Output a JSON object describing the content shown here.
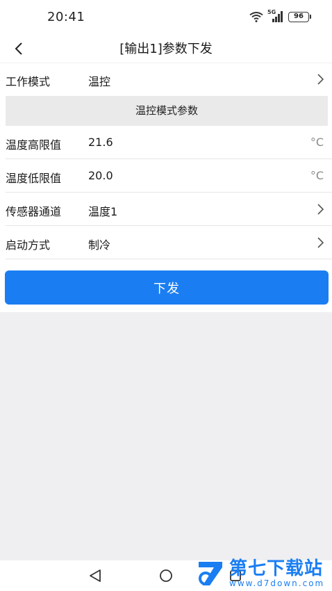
{
  "status_bar": {
    "time": "20:41",
    "network": "5G",
    "battery": "96"
  },
  "header": {
    "title": "[输出1]参数下发"
  },
  "form": {
    "work_mode": {
      "label": "工作模式",
      "value": "温控"
    },
    "section_title": "温控模式参数",
    "temp_high": {
      "label": "温度高限值",
      "value": "21.6",
      "unit": "°C"
    },
    "temp_low": {
      "label": "温度低限值",
      "value": "20.0",
      "unit": "°C"
    },
    "sensor_channel": {
      "label": "传感器通道",
      "value": "温度1"
    },
    "start_mode": {
      "label": "启动方式",
      "value": "制冷"
    }
  },
  "submit_label": "下发",
  "watermark": {
    "title": "第七下载站",
    "url": "www.d7down.com"
  },
  "colors": {
    "accent": "#1a7ef2",
    "page_bg": "#efeff1",
    "section_bg": "#eaeaea"
  }
}
